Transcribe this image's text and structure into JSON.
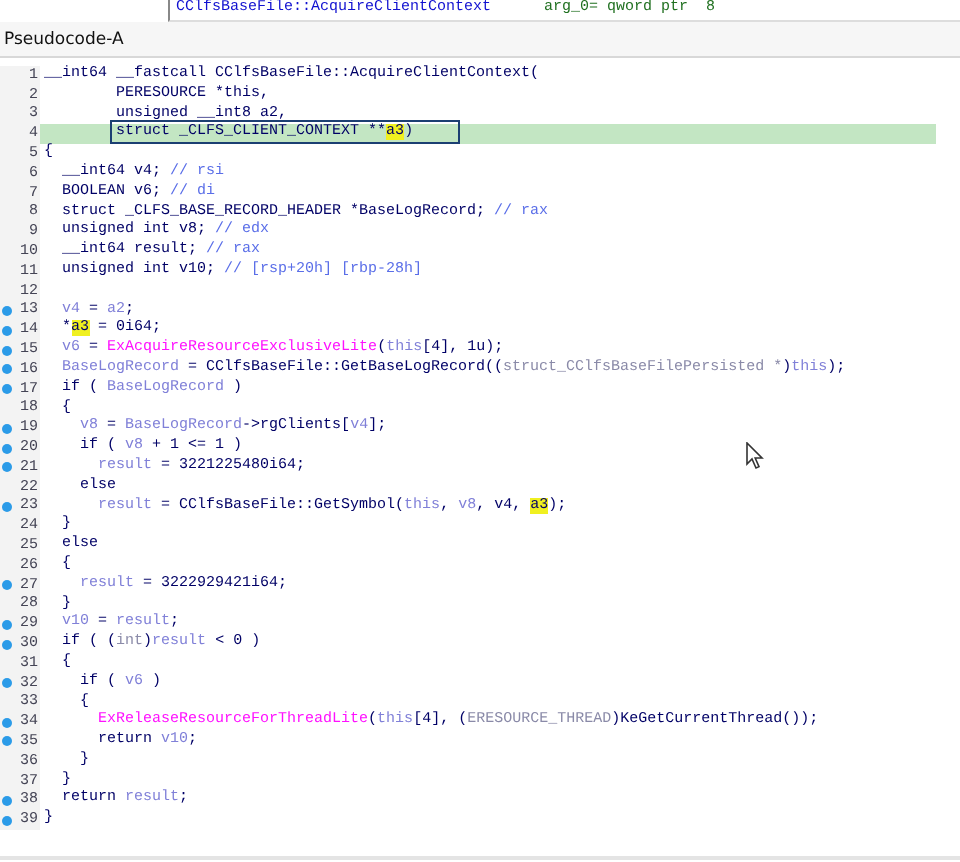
{
  "disassembly_strip": {
    "symbol": "CClfsBaseFile::AcquireClientContext",
    "operand": "arg_0= qword ptr  8"
  },
  "tab": {
    "title": "Pseudocode-A"
  },
  "lines": [
    {
      "number": "1",
      "breakpoint": false,
      "current": false,
      "boxed": false,
      "segments": [
        {
          "kind": "t",
          "text": "__int64 __fastcall CClfsBaseFile::AcquireClientContext("
        }
      ]
    },
    {
      "number": "2",
      "breakpoint": false,
      "current": false,
      "boxed": false,
      "segments": [
        {
          "kind": "t",
          "text": "        PERESOURCE *this,"
        }
      ]
    },
    {
      "number": "3",
      "breakpoint": false,
      "current": false,
      "boxed": false,
      "segments": [
        {
          "kind": "t",
          "text": "        unsigned __int8 a2,"
        }
      ]
    },
    {
      "number": "4",
      "breakpoint": false,
      "current": true,
      "boxed": true,
      "segments": [
        {
          "kind": "t",
          "text": "        struct _CLFS_CLIENT_CONTEXT **"
        },
        {
          "kind": "h",
          "text": "a3"
        },
        {
          "kind": "t",
          "text": ")"
        }
      ]
    },
    {
      "number": "5",
      "breakpoint": false,
      "current": false,
      "boxed": false,
      "segments": [
        {
          "kind": "t",
          "text": "{"
        }
      ]
    },
    {
      "number": "6",
      "breakpoint": false,
      "current": false,
      "boxed": false,
      "segments": [
        {
          "kind": "t",
          "text": "  __int64 v4; "
        },
        {
          "kind": "c",
          "text": "// rsi"
        }
      ]
    },
    {
      "number": "7",
      "breakpoint": false,
      "current": false,
      "boxed": false,
      "segments": [
        {
          "kind": "t",
          "text": "  BOOLEAN v6; "
        },
        {
          "kind": "c",
          "text": "// di"
        }
      ]
    },
    {
      "number": "8",
      "breakpoint": false,
      "current": false,
      "boxed": false,
      "segments": [
        {
          "kind": "t",
          "text": "  struct _CLFS_BASE_RECORD_HEADER *BaseLogRecord; "
        },
        {
          "kind": "c",
          "text": "// rax"
        }
      ]
    },
    {
      "number": "9",
      "breakpoint": false,
      "current": false,
      "boxed": false,
      "segments": [
        {
          "kind": "t",
          "text": "  unsigned int v8; "
        },
        {
          "kind": "c",
          "text": "// edx"
        }
      ]
    },
    {
      "number": "10",
      "breakpoint": false,
      "current": false,
      "boxed": false,
      "segments": [
        {
          "kind": "t",
          "text": "  __int64 result; "
        },
        {
          "kind": "c",
          "text": "// rax"
        }
      ]
    },
    {
      "number": "11",
      "breakpoint": false,
      "current": false,
      "boxed": false,
      "segments": [
        {
          "kind": "t",
          "text": "  unsigned int v10; "
        },
        {
          "kind": "c",
          "text": "// [rsp+20h] [rbp-28h]"
        }
      ]
    },
    {
      "number": "12",
      "breakpoint": false,
      "current": false,
      "boxed": false
    },
    {
      "number": "13",
      "breakpoint": true,
      "current": false,
      "boxed": false,
      "segments": [
        {
          "kind": "v",
          "text": "  v4"
        },
        {
          "kind": "t",
          "text": " = "
        },
        {
          "kind": "v",
          "text": "a2"
        },
        {
          "kind": "t",
          "text": ";"
        }
      ]
    },
    {
      "number": "14",
      "breakpoint": true,
      "current": false,
      "boxed": false,
      "segments": [
        {
          "kind": "t",
          "text": "  *"
        },
        {
          "kind": "h",
          "text": "a3"
        },
        {
          "kind": "t",
          "text": " = 0i64;"
        }
      ]
    },
    {
      "number": "15",
      "breakpoint": true,
      "current": false,
      "boxed": false,
      "segments": [
        {
          "kind": "v",
          "text": "  v6"
        },
        {
          "kind": "t",
          "text": " = "
        },
        {
          "kind": "f",
          "text": "ExAcquireResourceExclusiveLite"
        },
        {
          "kind": "t",
          "text": "("
        },
        {
          "kind": "v",
          "text": "this"
        },
        {
          "kind": "t",
          "text": "[4], 1u);"
        }
      ]
    },
    {
      "number": "16",
      "breakpoint": true,
      "current": false,
      "boxed": false,
      "segments": [
        {
          "kind": "v",
          "text": "  BaseLogRecord"
        },
        {
          "kind": "t",
          "text": " = CClfsBaseFile::GetBaseLogRecord(("
        },
        {
          "kind": "g",
          "text": "struct_CClfsBaseFilePersisted *"
        },
        {
          "kind": "t",
          "text": ")"
        },
        {
          "kind": "v",
          "text": "this"
        },
        {
          "kind": "t",
          "text": ");"
        }
      ]
    },
    {
      "number": "17",
      "breakpoint": true,
      "current": false,
      "boxed": false,
      "segments": [
        {
          "kind": "t",
          "text": "  if ( "
        },
        {
          "kind": "v",
          "text": "BaseLogRecord"
        },
        {
          "kind": "t",
          "text": " )"
        }
      ]
    },
    {
      "number": "18",
      "breakpoint": false,
      "current": false,
      "boxed": false,
      "segments": [
        {
          "kind": "t",
          "text": "  {"
        }
      ]
    },
    {
      "number": "19",
      "breakpoint": true,
      "current": false,
      "boxed": false,
      "segments": [
        {
          "kind": "v",
          "text": "    v8"
        },
        {
          "kind": "t",
          "text": " = "
        },
        {
          "kind": "v",
          "text": "BaseLogRecord"
        },
        {
          "kind": "t",
          "text": "->rgClients["
        },
        {
          "kind": "v",
          "text": "v4"
        },
        {
          "kind": "t",
          "text": "];"
        }
      ]
    },
    {
      "number": "20",
      "breakpoint": true,
      "current": false,
      "boxed": false,
      "segments": [
        {
          "kind": "t",
          "text": "    if ( "
        },
        {
          "kind": "v",
          "text": "v8"
        },
        {
          "kind": "t",
          "text": " + 1 <= 1 )"
        }
      ]
    },
    {
      "number": "21",
      "breakpoint": true,
      "current": false,
      "boxed": false,
      "segments": [
        {
          "kind": "v",
          "text": "      result"
        },
        {
          "kind": "t",
          "text": " = 3221225480i64;"
        }
      ]
    },
    {
      "number": "22",
      "breakpoint": false,
      "current": false,
      "boxed": false,
      "segments": [
        {
          "kind": "t",
          "text": "    else"
        }
      ]
    },
    {
      "number": "23",
      "breakpoint": true,
      "current": false,
      "boxed": false,
      "segments": [
        {
          "kind": "v",
          "text": "      result"
        },
        {
          "kind": "t",
          "text": " = CClfsBaseFile::GetSymbol("
        },
        {
          "kind": "v",
          "text": "this"
        },
        {
          "kind": "t",
          "text": ", "
        },
        {
          "kind": "v",
          "text": "v8"
        },
        {
          "kind": "t",
          "text": ", v4, "
        },
        {
          "kind": "h",
          "text": "a3"
        },
        {
          "kind": "t",
          "text": ");"
        }
      ]
    },
    {
      "number": "24",
      "breakpoint": false,
      "current": false,
      "boxed": false,
      "segments": [
        {
          "kind": "t",
          "text": "  }"
        }
      ]
    },
    {
      "number": "25",
      "breakpoint": false,
      "current": false,
      "boxed": false,
      "segments": [
        {
          "kind": "t",
          "text": "  else"
        }
      ]
    },
    {
      "number": "26",
      "breakpoint": false,
      "current": false,
      "boxed": false,
      "segments": [
        {
          "kind": "t",
          "text": "  {"
        }
      ]
    },
    {
      "number": "27",
      "breakpoint": true,
      "current": false,
      "boxed": false,
      "segments": [
        {
          "kind": "v",
          "text": "    result"
        },
        {
          "kind": "t",
          "text": " = 3222929421i64;"
        }
      ]
    },
    {
      "number": "28",
      "breakpoint": false,
      "current": false,
      "boxed": false,
      "segments": [
        {
          "kind": "t",
          "text": "  }"
        }
      ]
    },
    {
      "number": "29",
      "breakpoint": true,
      "current": false,
      "boxed": false,
      "segments": [
        {
          "kind": "v",
          "text": "  v10"
        },
        {
          "kind": "t",
          "text": " = "
        },
        {
          "kind": "v",
          "text": "result"
        },
        {
          "kind": "t",
          "text": ";"
        }
      ]
    },
    {
      "number": "30",
      "breakpoint": true,
      "current": false,
      "boxed": false,
      "segments": [
        {
          "kind": "t",
          "text": "  if ( ("
        },
        {
          "kind": "g",
          "text": "int"
        },
        {
          "kind": "t",
          "text": ")"
        },
        {
          "kind": "v",
          "text": "result"
        },
        {
          "kind": "t",
          "text": " < 0 )"
        }
      ]
    },
    {
      "number": "31",
      "breakpoint": false,
      "current": false,
      "boxed": false,
      "segments": [
        {
          "kind": "t",
          "text": "  {"
        }
      ]
    },
    {
      "number": "32",
      "breakpoint": true,
      "current": false,
      "boxed": false,
      "segments": [
        {
          "kind": "t",
          "text": "    if ( "
        },
        {
          "kind": "v",
          "text": "v6"
        },
        {
          "kind": "t",
          "text": " )"
        }
      ]
    },
    {
      "number": "33",
      "breakpoint": false,
      "current": false,
      "boxed": false,
      "segments": [
        {
          "kind": "t",
          "text": "    {"
        }
      ]
    },
    {
      "number": "34",
      "breakpoint": true,
      "current": false,
      "boxed": false,
      "segments": [
        {
          "kind": "f",
          "text": "      ExReleaseResourceForThreadLite"
        },
        {
          "kind": "t",
          "text": "("
        },
        {
          "kind": "v",
          "text": "this"
        },
        {
          "kind": "t",
          "text": "[4], ("
        },
        {
          "kind": "g",
          "text": "ERESOURCE_THREAD"
        },
        {
          "kind": "t",
          "text": ")KeGetCurrentThread());"
        }
      ]
    },
    {
      "number": "35",
      "breakpoint": true,
      "current": false,
      "boxed": false,
      "segments": [
        {
          "kind": "t",
          "text": "      return "
        },
        {
          "kind": "v",
          "text": "v10"
        },
        {
          "kind": "t",
          "text": ";"
        }
      ]
    },
    {
      "number": "36",
      "breakpoint": false,
      "current": false,
      "boxed": false,
      "segments": [
        {
          "kind": "t",
          "text": "    }"
        }
      ]
    },
    {
      "number": "37",
      "breakpoint": false,
      "current": false,
      "boxed": false,
      "segments": [
        {
          "kind": "t",
          "text": "  }"
        }
      ]
    },
    {
      "number": "38",
      "breakpoint": true,
      "current": false,
      "boxed": false,
      "segments": [
        {
          "kind": "t",
          "text": "  return "
        },
        {
          "kind": "v",
          "text": "result"
        },
        {
          "kind": "t",
          "text": ";"
        }
      ]
    },
    {
      "number": "39",
      "breakpoint": true,
      "current": false,
      "boxed": false,
      "segments": [
        {
          "kind": "t",
          "text": "}"
        }
      ]
    }
  ]
}
